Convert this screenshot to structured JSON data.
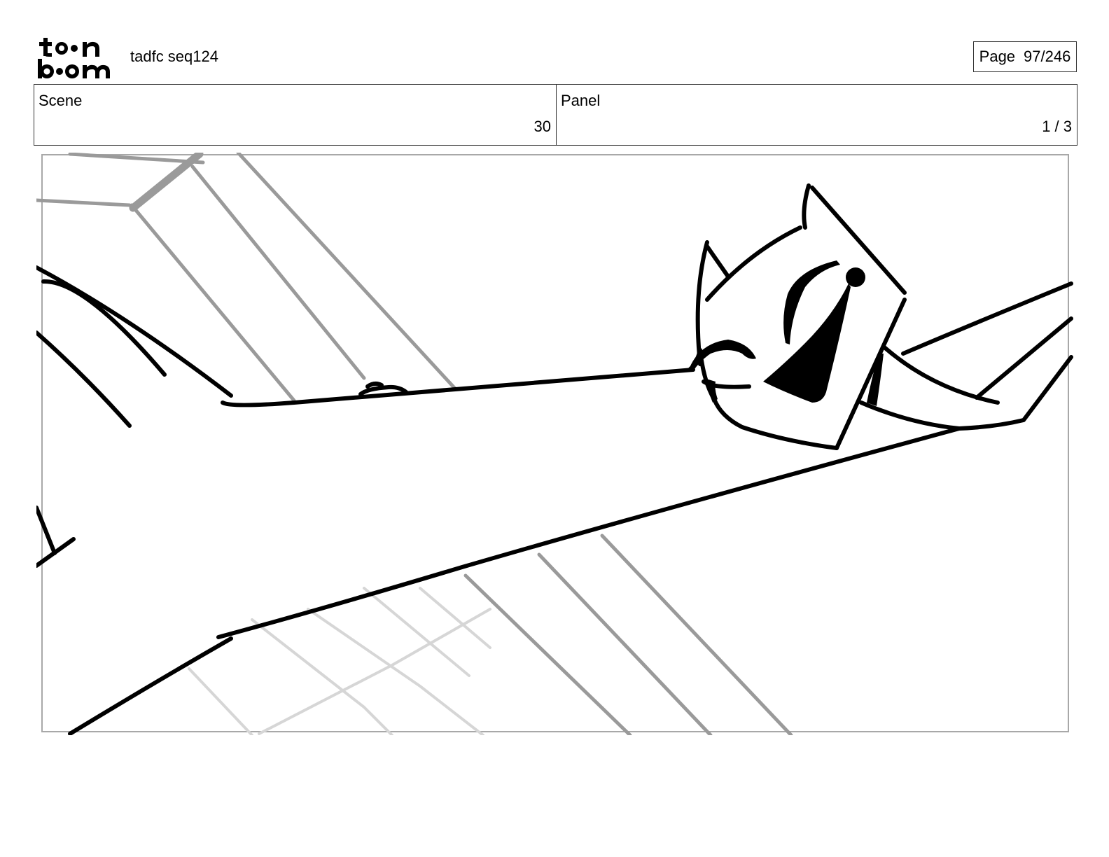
{
  "header": {
    "logo_text": "toon boom",
    "title": "tadfc seq124",
    "page_label": "Page",
    "page_value": "97/246"
  },
  "scene": {
    "label": "Scene",
    "value": "30"
  },
  "panel": {
    "label": "Panel",
    "value": "1 / 3"
  }
}
